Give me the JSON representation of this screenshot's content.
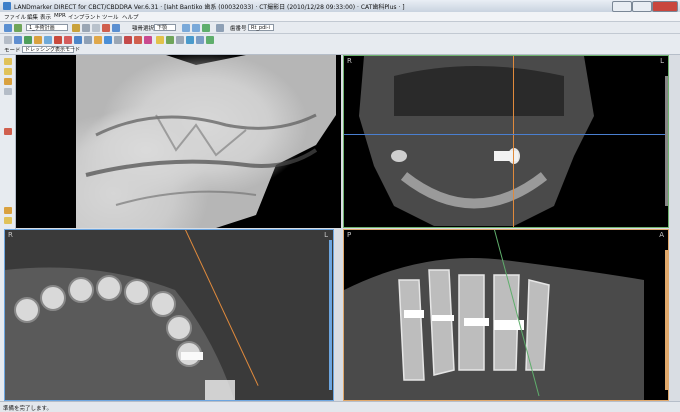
{
  "window": {
    "title": "LANDmarker DIRECT for CBCT/CBDDRA Ver.6.31 · [Iaht Bantiko 歯系 (00032033) · CT撮影日 (2010/12/28 09:33:00) · CAT歯科Plus · ]"
  },
  "menu": [
    "ファイル",
    "編集",
    "表示",
    "MPR",
    "インプラント",
    "ツール",
    "ヘルプ"
  ],
  "toolbar1": {
    "combo1": "1_手術計画",
    "combo2_label": "顎骨選択",
    "combo2": "下顎",
    "combo3_label": "歯番号",
    "combo3": "Rt_pdi-i"
  },
  "toolbar3": {
    "mode_label": "モード",
    "mode_value": "ドレッシング表示モード"
  },
  "viewports": {
    "coronal": {
      "left": "R",
      "right": "L"
    },
    "axial": {
      "left": "R",
      "right": "L"
    },
    "sagittal": {
      "left": "P",
      "right": "A"
    }
  },
  "status": {
    "text": "準備を完了します。"
  },
  "colors": {
    "coronal_border": "#6fb36f",
    "axial_border": "#6da6e0",
    "sagittal_border": "#e0a86b"
  }
}
